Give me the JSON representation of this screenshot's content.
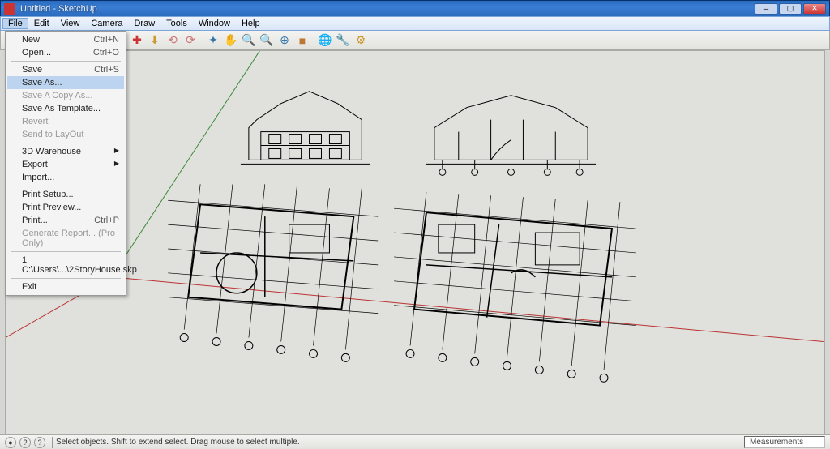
{
  "window": {
    "title": "Untitled - SketchUp"
  },
  "menubar": [
    "File",
    "Edit",
    "View",
    "Camera",
    "Draw",
    "Tools",
    "Window",
    "Help"
  ],
  "toolbar_icons": [
    "✚",
    "⬇",
    "⟲",
    "⟳",
    "✦",
    "✋",
    "🔍",
    "🔍",
    "⊕",
    "■",
    "🌐",
    "🔧",
    "⚙"
  ],
  "file_menu": [
    {
      "label": "New",
      "shortcut": "Ctrl+N",
      "type": "item"
    },
    {
      "label": "Open...",
      "shortcut": "Ctrl+O",
      "type": "item"
    },
    {
      "type": "sep"
    },
    {
      "label": "Save",
      "shortcut": "Ctrl+S",
      "type": "item"
    },
    {
      "label": "Save As...",
      "type": "item",
      "highlight": true
    },
    {
      "label": "Save A Copy As...",
      "type": "item",
      "disabled": true
    },
    {
      "label": "Save As Template...",
      "type": "item"
    },
    {
      "label": "Revert",
      "type": "item",
      "disabled": true
    },
    {
      "label": "Send to LayOut",
      "type": "item",
      "disabled": true
    },
    {
      "type": "sep"
    },
    {
      "label": "3D Warehouse",
      "type": "submenu"
    },
    {
      "label": "Export",
      "type": "submenu"
    },
    {
      "label": "Import...",
      "type": "item"
    },
    {
      "type": "sep"
    },
    {
      "label": "Print Setup...",
      "type": "item"
    },
    {
      "label": "Print Preview...",
      "type": "item"
    },
    {
      "label": "Print...",
      "shortcut": "Ctrl+P",
      "type": "item"
    },
    {
      "label": "Generate Report... (Pro Only)",
      "type": "item",
      "disabled": true
    },
    {
      "type": "sep"
    },
    {
      "label": "1 C:\\Users\\...\\2StoryHouse.skp",
      "type": "item"
    },
    {
      "type": "sep"
    },
    {
      "label": "Exit",
      "type": "item"
    }
  ],
  "status": {
    "hint": "Select objects. Shift to extend select. Drag mouse to select multiple.",
    "measurements_label": "Measurements"
  }
}
